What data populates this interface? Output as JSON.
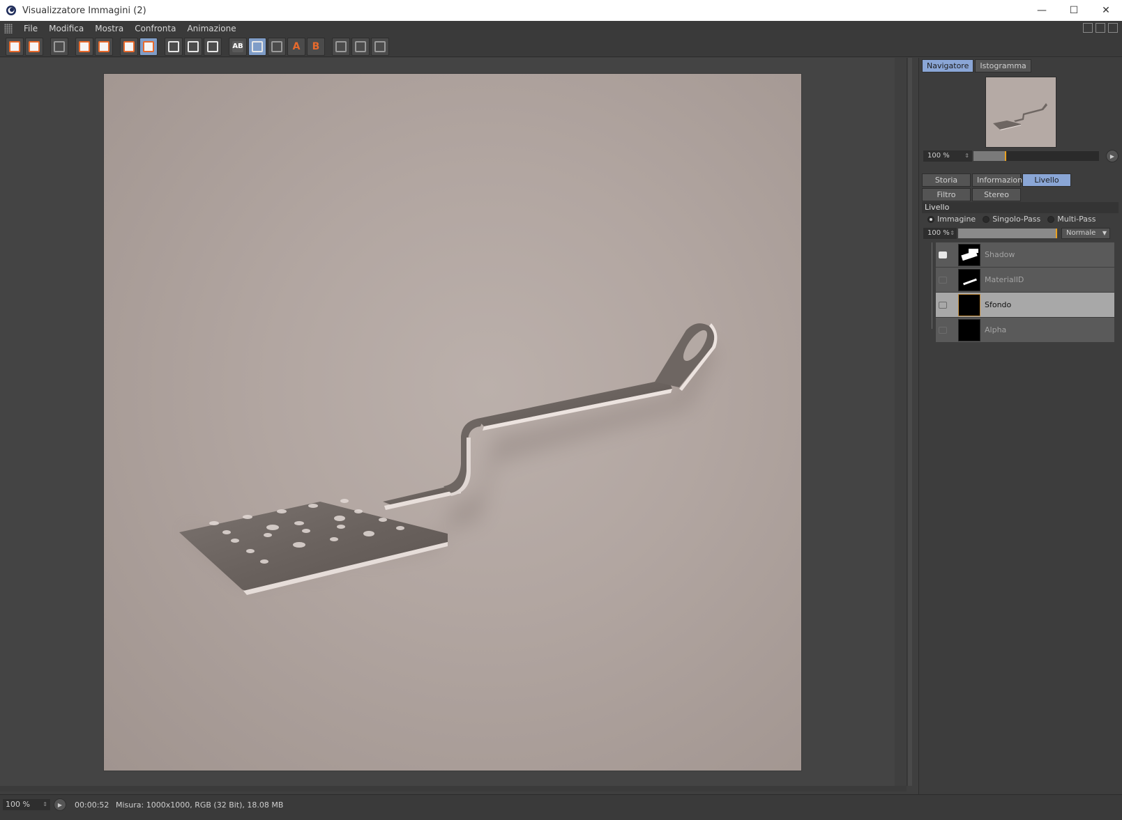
{
  "window": {
    "title": "Visualizzatore Immagini (2)",
    "minimize_glyph": "—",
    "maximize_glyph": "☐",
    "close_glyph": "✕"
  },
  "menu": {
    "items": [
      "File",
      "Modifica",
      "Mostra",
      "Confronta",
      "Animazione"
    ]
  },
  "toolbar": {
    "icons": [
      "open-icon",
      "save-icon",
      "grid-icon",
      "crop-icon",
      "user-icon",
      "layer-stack-icon",
      "layer-active-icon",
      "region-a-icon",
      "region-b-icon",
      "region-c-icon",
      "compare-ab-icon",
      "compare-swap-icon",
      "compare-ab-dim-icon",
      "set-a-icon",
      "set-b-icon",
      "grid-2-icon",
      "grid-3-icon",
      "grid-4-icon"
    ],
    "ab_label": "AB",
    "a_label": "A",
    "b_label": "B"
  },
  "navigator": {
    "tab_navigator": "Navigatore",
    "tab_histogram": "Istogramma",
    "zoom": "100 %",
    "zoom_fraction": 0.25
  },
  "panel_tabs": {
    "history": "Storia",
    "info": "Informazioni",
    "layer": "Livello",
    "filter": "Filtro",
    "stereo": "Stereo"
  },
  "layer_section": {
    "heading": "Livello",
    "radio_image": "Immagine",
    "radio_single": "Singolo-Pass",
    "radio_multi": "Multi-Pass",
    "opacity": "100 %",
    "blend_mode": "Normale",
    "layers": [
      {
        "name": "Shadow",
        "visible": true,
        "selected": false
      },
      {
        "name": "MaterialID",
        "visible": false,
        "selected": false
      },
      {
        "name": "Sfondo",
        "visible": false,
        "selected": true
      },
      {
        "name": "Alpha",
        "visible": false,
        "selected": false
      }
    ]
  },
  "status": {
    "zoom": "100 %",
    "time": "00:00:52",
    "info": "Misura: 1000x1000, RGB (32 Bit), 18.08 MB"
  },
  "colors": {
    "accent_blue": "#8aa6d6",
    "accent_orange": "#e86a2c",
    "render_bg": "#b2a6a1"
  }
}
